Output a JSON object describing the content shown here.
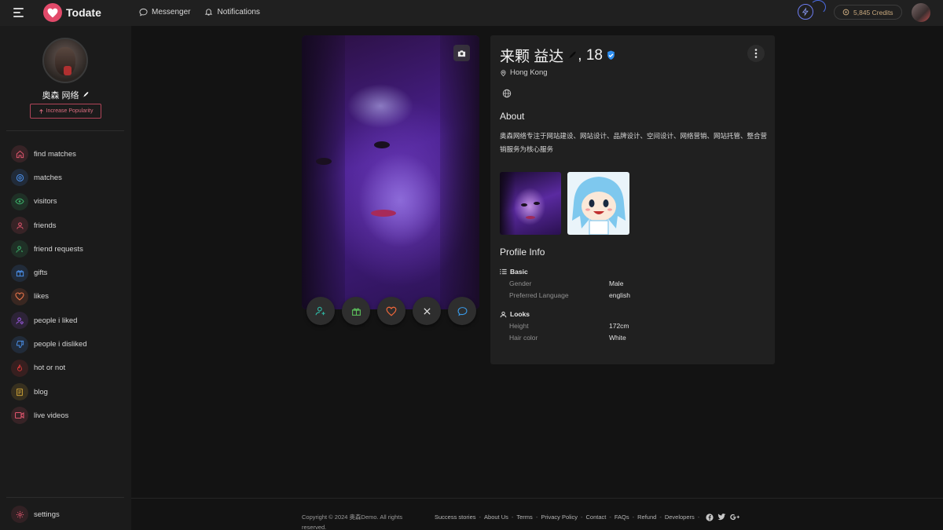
{
  "app": {
    "name": "Todate"
  },
  "topnav": {
    "messenger": "Messenger",
    "notifications": "Notifications"
  },
  "credits": {
    "label": "5,845 Credits"
  },
  "sidebar": {
    "user_name": "奥森 网络",
    "popularity_button": "Increase Popularity",
    "items": [
      {
        "label": "find matches",
        "icon": "home-icon",
        "color": "#e0566e"
      },
      {
        "label": "matches",
        "icon": "target-icon",
        "color": "#4a8ee8"
      },
      {
        "label": "visitors",
        "icon": "eye-icon",
        "color": "#3cb06a"
      },
      {
        "label": "friends",
        "icon": "user-icon",
        "color": "#e0566e"
      },
      {
        "label": "friend requests",
        "icon": "user-clock-icon",
        "color": "#3cb06a"
      },
      {
        "label": "gifts",
        "icon": "gift-icon",
        "color": "#4a8ee8"
      },
      {
        "label": "likes",
        "icon": "heart-icon",
        "color": "#e8744a"
      },
      {
        "label": "people i liked",
        "icon": "user-heart-icon",
        "color": "#9a5ae0"
      },
      {
        "label": "people i disliked",
        "icon": "thumbs-down-icon",
        "color": "#4a8ee8"
      },
      {
        "label": "hot or not",
        "icon": "flame-icon",
        "color": "#e03a3a"
      },
      {
        "label": "blog",
        "icon": "document-icon",
        "color": "#e0b03a"
      },
      {
        "label": "live videos",
        "icon": "video-icon",
        "color": "#e0566e"
      }
    ],
    "settings": "settings"
  },
  "profile": {
    "name": "来颗 益达",
    "age": ", 18",
    "location": "Hong Kong",
    "about_title": "About",
    "about_text": "奥森网络专注于网站建设、网站设计、品牌设计、空间设计、网络营销、网站托管、整合营销服务为核心服务",
    "profile_info_title": "Profile Info",
    "basic": {
      "title": "Basic",
      "rows": [
        {
          "key": "Gender",
          "value": "Male"
        },
        {
          "key": "Preferred Language",
          "value": "english"
        }
      ]
    },
    "looks": {
      "title": "Looks",
      "rows": [
        {
          "key": "Height",
          "value": "172cm"
        },
        {
          "key": "Hair color",
          "value": "White"
        }
      ]
    }
  },
  "footer": {
    "copyright": "Copyright © 2024 奥森Demo. All rights reserved.",
    "links": [
      "Success stories",
      "About Us",
      "Terms",
      "Privacy Policy",
      "Contact",
      "FAQs",
      "Refund",
      "Developers"
    ]
  }
}
